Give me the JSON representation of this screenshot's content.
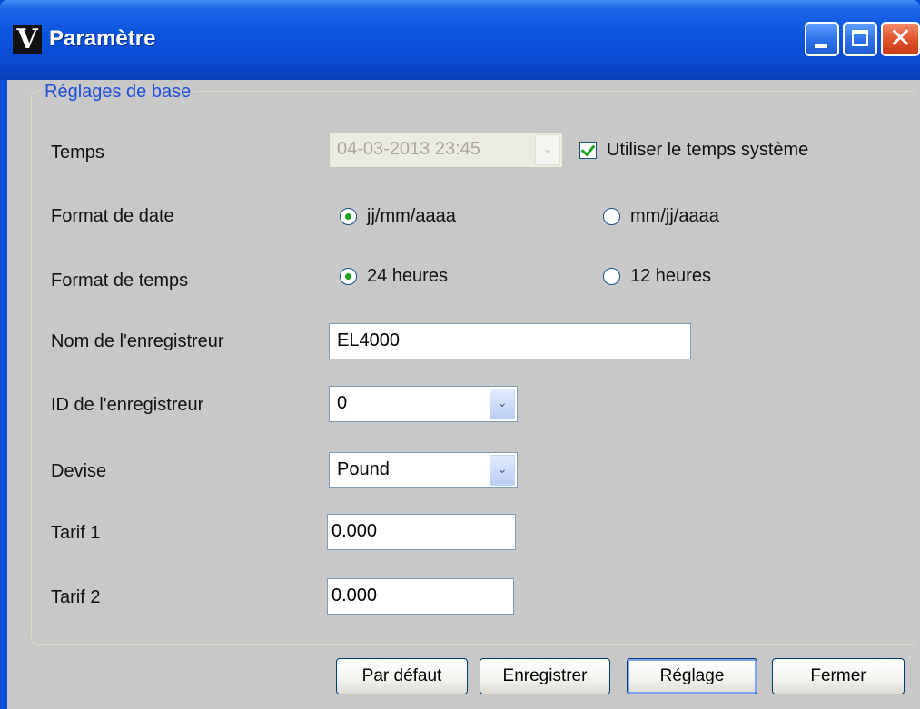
{
  "window": {
    "title": "Paramètre",
    "logo_glyph": "V",
    "logo_icon": "app-logo-icon",
    "controls": {
      "minimize_icon": "minimize-icon",
      "maximize_icon": "maximize-icon",
      "close_icon": "close-icon",
      "close_glyph": "✕"
    }
  },
  "group": {
    "title": "Réglages de base"
  },
  "fields": {
    "time": {
      "label": "Temps",
      "value": "04-03-2013 23:45",
      "disabled": true,
      "dropdown_glyph": "⌄",
      "use_system_time_label": "Utiliser le temps système",
      "use_system_time_checked": true
    },
    "date_format": {
      "label": "Format de date",
      "options": [
        "jj/mm/aaaa",
        "mm/jj/aaaa"
      ],
      "selected": "jj/mm/aaaa"
    },
    "time_format": {
      "label": "Format de temps",
      "options": [
        "24 heures",
        "12 heures"
      ],
      "selected": "24 heures"
    },
    "logger_name": {
      "label": "Nom de l'enregistreur",
      "value": "EL4000"
    },
    "logger_id": {
      "label": "ID de l'enregistreur",
      "value": "0",
      "dropdown_glyph": "⌄"
    },
    "currency": {
      "label": "Devise",
      "value": "Pound",
      "dropdown_glyph": "⌄"
    },
    "tariff1": {
      "label": "Tarif 1",
      "value": "0.000"
    },
    "tariff2": {
      "label": "Tarif 2",
      "value": "0.000"
    }
  },
  "buttons": {
    "default": "Par défaut",
    "save": "Enregistrer",
    "apply": "Réglage",
    "close": "Fermer"
  },
  "colors": {
    "titlebar": "#0a4cd2",
    "client_bg": "#c8c8c8",
    "group_title": "#1f4fd8",
    "check_green": "#21a121"
  }
}
